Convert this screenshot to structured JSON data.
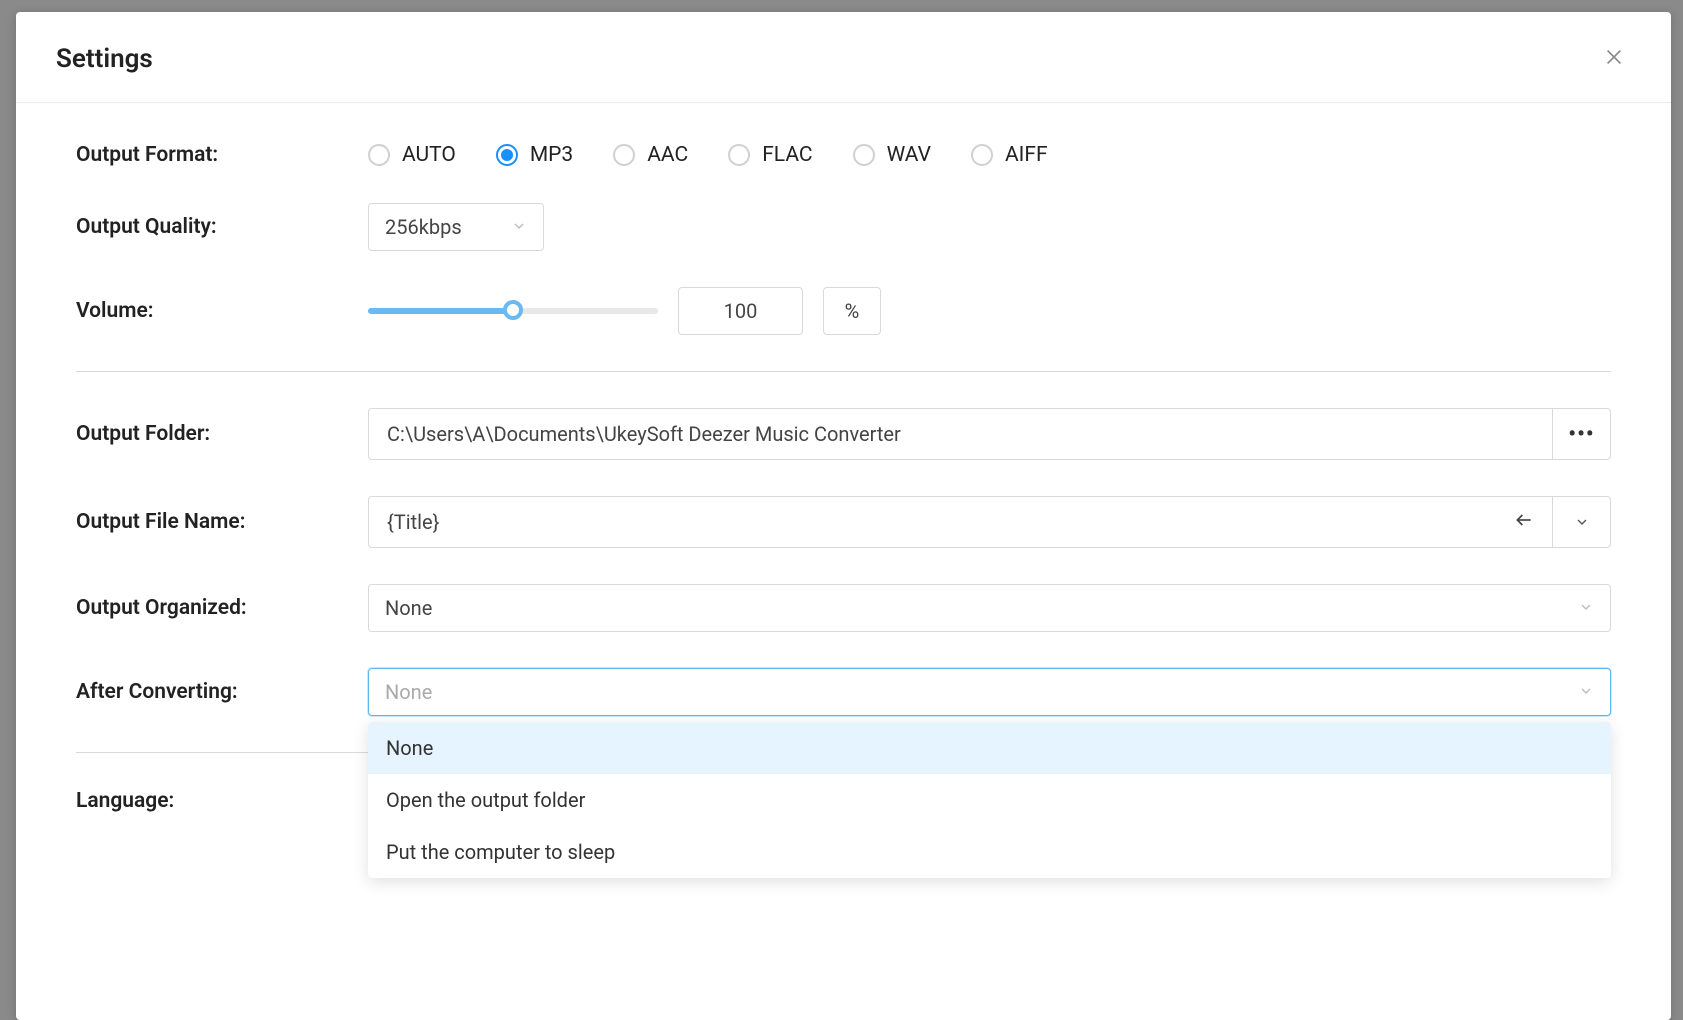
{
  "title": "Settings",
  "labels": {
    "output_format": "Output Format:",
    "output_quality": "Output Quality:",
    "volume": "Volume:",
    "output_folder": "Output Folder:",
    "output_file_name": "Output File Name:",
    "output_organized": "Output Organized:",
    "after_converting": "After Converting:",
    "language": "Language:"
  },
  "output_format": {
    "options": [
      "AUTO",
      "MP3",
      "AAC",
      "FLAC",
      "WAV",
      "AIFF"
    ],
    "selected": "MP3"
  },
  "output_quality": {
    "value": "256kbps"
  },
  "volume": {
    "value": "100",
    "unit": "%"
  },
  "output_folder": {
    "value": "C:\\Users\\A\\Documents\\UkeySoft Deezer Music Converter"
  },
  "output_file_name": {
    "value": "{Title}"
  },
  "output_organized": {
    "value": "None"
  },
  "after_converting": {
    "value": "None",
    "options": [
      "None",
      "Open the output folder",
      "Put the computer to sleep"
    ],
    "highlighted": "None"
  },
  "browse_dots": "•••"
}
